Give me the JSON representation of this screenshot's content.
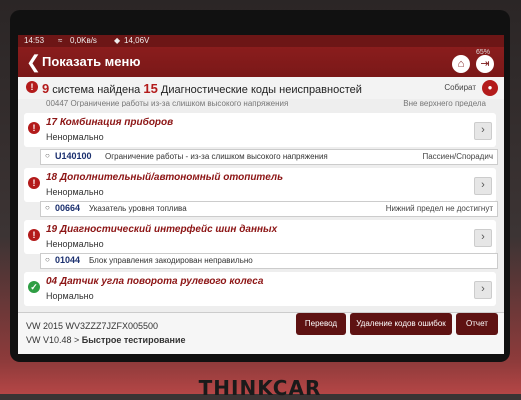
{
  "status_bar": {
    "time": "14:53",
    "speed": "0,0Kв/s",
    "voltage": "14,06V",
    "battery": "65%"
  },
  "header": {
    "title": "Показать меню"
  },
  "summary": {
    "systems_count": "9",
    "systems_text": "система найдена",
    "codes_count": "15",
    "codes_text": "Диагностические коды неисправностей",
    "collect_label": "Собират"
  },
  "partial_row": {
    "code": "00447",
    "desc": "Ограничение работы из-за слишком высокого напряжения",
    "status": "Вне верхнего предела"
  },
  "systems": [
    {
      "name": "17 Комбинация приборов",
      "state": "Ненормально",
      "dtc": {
        "code": "U140100",
        "desc": "Ограничение работы - из-за слишком высокого напряжения",
        "status": "Пассиен/Спорадич"
      }
    },
    {
      "name": "18 Дополнительный/автономный отопитель",
      "state": "Ненормально",
      "dtc": {
        "code": "00664",
        "desc": "Указатель уровня топлива",
        "status": "Нижний предел не достигнут"
      }
    },
    {
      "name": "19 Диагностический интерфейс шин данных",
      "state": "Ненормально",
      "dtc": {
        "code": "01044",
        "desc": "Блок управления закодирован неправильно",
        "status": ""
      }
    },
    {
      "name": "04 Датчик угла поворота рулевого колеса",
      "state": "Нормально",
      "dtc": null
    }
  ],
  "footer": {
    "vin_line": "VW  2015  WV3ZZZ7JZFX005500",
    "version_prefix": "VW V10.48 > ",
    "version_mode": "Быстрое тестирование",
    "translate_label": "Перевод",
    "clear_codes_label": "Удаление кодов ошибок",
    "report_label": "Отчет"
  },
  "device": {
    "brand": "THINKCAR"
  }
}
